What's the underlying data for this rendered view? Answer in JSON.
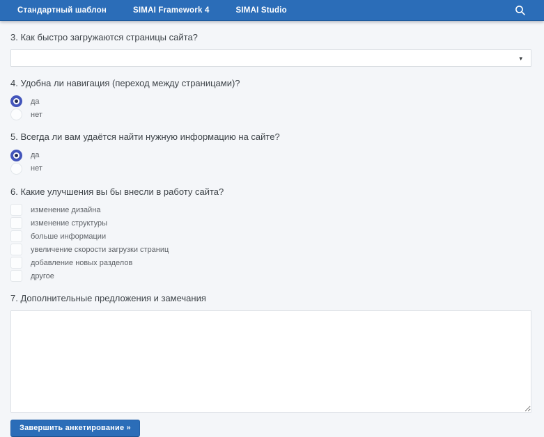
{
  "nav": {
    "tabs": [
      "Стандартный шаблон",
      "SIMAI Framework 4",
      "SIMAI Studio"
    ],
    "search_icon": "magnifier"
  },
  "form": {
    "q3": {
      "label": "3. Как быстро загружаются страницы сайта?",
      "type": "select",
      "selected_value": ""
    },
    "q4": {
      "label": "4. Удобна ли навигация (переход между страницами)?",
      "type": "radio",
      "options": [
        {
          "label": "да",
          "checked": true
        },
        {
          "label": "нет",
          "checked": false
        }
      ]
    },
    "q5": {
      "label": "5. Всегда ли вам удаётся найти нужную информацию на сайте?",
      "type": "radio",
      "options": [
        {
          "label": "да",
          "checked": true
        },
        {
          "label": "нет",
          "checked": false
        }
      ]
    },
    "q6": {
      "label": "6. Какие улучшения вы бы внесли в работу сайта?",
      "type": "checkbox",
      "options": [
        {
          "label": "изменение дизайна",
          "checked": false
        },
        {
          "label": "изменение структуры",
          "checked": false
        },
        {
          "label": "больше информации",
          "checked": false
        },
        {
          "label": "увеличение скорости загрузки страниц",
          "checked": false
        },
        {
          "label": "добавление новых разделов",
          "checked": false
        },
        {
          "label": "другое",
          "checked": false
        }
      ]
    },
    "q7": {
      "label": "7. Дополнительные предложения и замечания",
      "type": "textarea",
      "value": ""
    },
    "submit_label": "Завершить анкетирование »"
  },
  "colors": {
    "nav_blue": "#2b6db8",
    "button_blue": "#2b6db8",
    "radio_accent": "#4355bb",
    "page_background": "#f4f6f9"
  }
}
